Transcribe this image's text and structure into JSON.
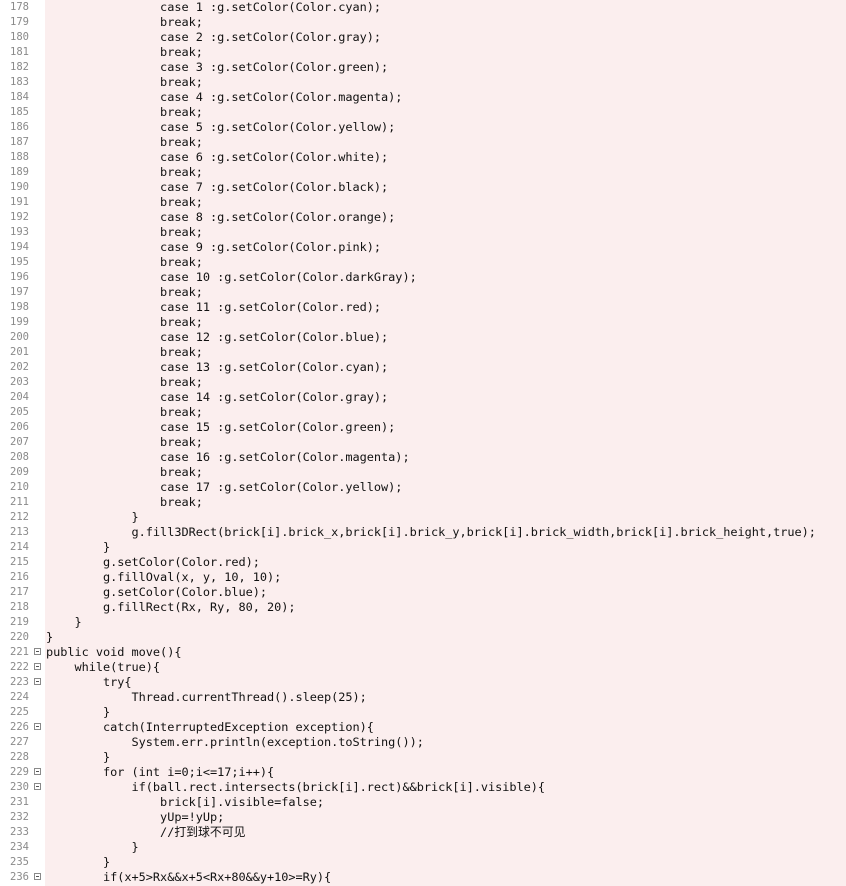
{
  "editor": {
    "lines": [
      {
        "no": "178",
        "code": "                case 1 :g.setColor(Color.cyan);",
        "fold": false
      },
      {
        "no": "179",
        "code": "                break;",
        "fold": false
      },
      {
        "no": "180",
        "code": "                case 2 :g.setColor(Color.gray);",
        "fold": false
      },
      {
        "no": "181",
        "code": "                break;",
        "fold": false
      },
      {
        "no": "182",
        "code": "                case 3 :g.setColor(Color.green);",
        "fold": false
      },
      {
        "no": "183",
        "code": "                break;",
        "fold": false
      },
      {
        "no": "184",
        "code": "                case 4 :g.setColor(Color.magenta);",
        "fold": false
      },
      {
        "no": "185",
        "code": "                break;",
        "fold": false
      },
      {
        "no": "186",
        "code": "                case 5 :g.setColor(Color.yellow);",
        "fold": false
      },
      {
        "no": "187",
        "code": "                break;",
        "fold": false
      },
      {
        "no": "188",
        "code": "                case 6 :g.setColor(Color.white);",
        "fold": false
      },
      {
        "no": "189",
        "code": "                break;",
        "fold": false
      },
      {
        "no": "190",
        "code": "                case 7 :g.setColor(Color.black);",
        "fold": false
      },
      {
        "no": "191",
        "code": "                break;",
        "fold": false
      },
      {
        "no": "192",
        "code": "                case 8 :g.setColor(Color.orange);",
        "fold": false
      },
      {
        "no": "193",
        "code": "                break;",
        "fold": false
      },
      {
        "no": "194",
        "code": "                case 9 :g.setColor(Color.pink);",
        "fold": false
      },
      {
        "no": "195",
        "code": "                break;",
        "fold": false
      },
      {
        "no": "196",
        "code": "                case 10 :g.setColor(Color.darkGray);",
        "fold": false
      },
      {
        "no": "197",
        "code": "                break;",
        "fold": false
      },
      {
        "no": "198",
        "code": "                case 11 :g.setColor(Color.red);",
        "fold": false
      },
      {
        "no": "199",
        "code": "                break;",
        "fold": false
      },
      {
        "no": "200",
        "code": "                case 12 :g.setColor(Color.blue);",
        "fold": false
      },
      {
        "no": "201",
        "code": "                break;",
        "fold": false
      },
      {
        "no": "202",
        "code": "                case 13 :g.setColor(Color.cyan);",
        "fold": false
      },
      {
        "no": "203",
        "code": "                break;",
        "fold": false
      },
      {
        "no": "204",
        "code": "                case 14 :g.setColor(Color.gray);",
        "fold": false
      },
      {
        "no": "205",
        "code": "                break;",
        "fold": false
      },
      {
        "no": "206",
        "code": "                case 15 :g.setColor(Color.green);",
        "fold": false
      },
      {
        "no": "207",
        "code": "                break;",
        "fold": false
      },
      {
        "no": "208",
        "code": "                case 16 :g.setColor(Color.magenta);",
        "fold": false
      },
      {
        "no": "209",
        "code": "                break;",
        "fold": false
      },
      {
        "no": "210",
        "code": "                case 17 :g.setColor(Color.yellow);",
        "fold": false
      },
      {
        "no": "211",
        "code": "                break;",
        "fold": false
      },
      {
        "no": "212",
        "code": "            }",
        "fold": false
      },
      {
        "no": "213",
        "code": "            g.fill3DRect(brick[i].brick_x,brick[i].brick_y,brick[i].brick_width,brick[i].brick_height,true);",
        "fold": false
      },
      {
        "no": "214",
        "code": "        }",
        "fold": false
      },
      {
        "no": "215",
        "code": "        g.setColor(Color.red);",
        "fold": false
      },
      {
        "no": "216",
        "code": "        g.fillOval(x, y, 10, 10);",
        "fold": false
      },
      {
        "no": "217",
        "code": "        g.setColor(Color.blue);",
        "fold": false
      },
      {
        "no": "218",
        "code": "        g.fillRect(Rx, Ry, 80, 20);",
        "fold": false
      },
      {
        "no": "219",
        "code": "    }",
        "fold": false
      },
      {
        "no": "220",
        "code": "}",
        "fold": false
      },
      {
        "no": "221",
        "code": "public void move(){",
        "fold": true
      },
      {
        "no": "222",
        "code": "    while(true){",
        "fold": true
      },
      {
        "no": "223",
        "code": "        try{",
        "fold": true
      },
      {
        "no": "224",
        "code": "            Thread.currentThread().sleep(25);",
        "fold": false
      },
      {
        "no": "225",
        "code": "        }",
        "fold": false
      },
      {
        "no": "226",
        "code": "        catch(InterruptedException exception){",
        "fold": true
      },
      {
        "no": "227",
        "code": "            System.err.println(exception.toString());",
        "fold": false
      },
      {
        "no": "228",
        "code": "        }",
        "fold": false
      },
      {
        "no": "229",
        "code": "        for (int i=0;i<=17;i++){",
        "fold": true
      },
      {
        "no": "230",
        "code": "            if(ball.rect.intersects(brick[i].rect)&&brick[i].visible){",
        "fold": true
      },
      {
        "no": "231",
        "code": "                brick[i].visible=false;",
        "fold": false
      },
      {
        "no": "232",
        "code": "                yUp=!yUp;",
        "fold": false
      },
      {
        "no": "233",
        "code": "                //打到球不可见",
        "fold": false
      },
      {
        "no": "234",
        "code": "            }",
        "fold": false
      },
      {
        "no": "235",
        "code": "        }",
        "fold": false
      },
      {
        "no": "236",
        "code": "        if(x+5>Rx&&x+5<Rx+80&&y+10>=Ry){",
        "fold": true
      }
    ]
  }
}
